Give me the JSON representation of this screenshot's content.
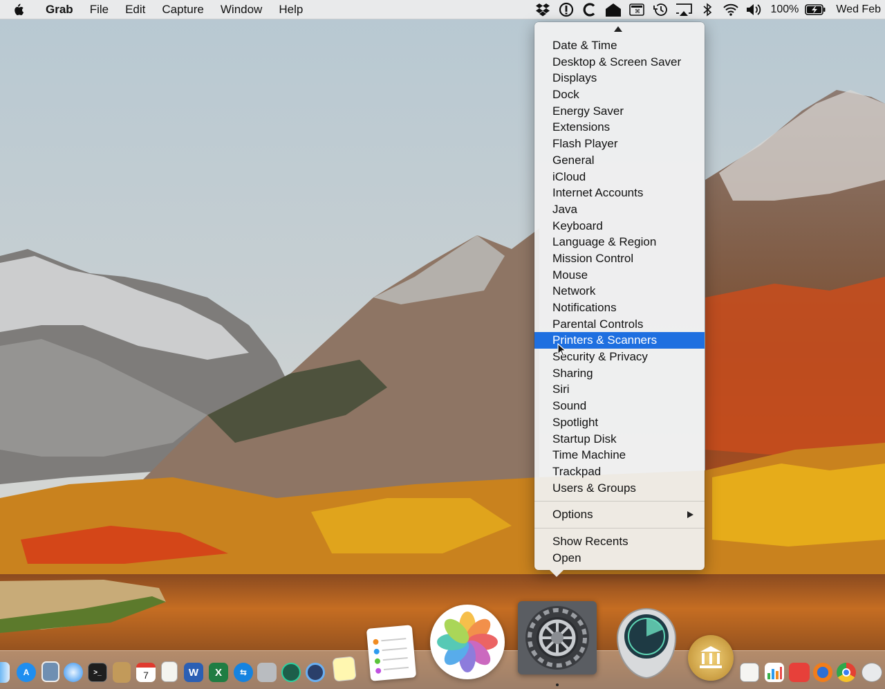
{
  "menubar": {
    "apple_icon": "apple-logo-icon",
    "app_name": "Grab",
    "menus": [
      "File",
      "Edit",
      "Capture",
      "Window",
      "Help"
    ],
    "status_icons": [
      "dropbox-icon",
      "info-circle-icon",
      "c-app-icon",
      "house-icon",
      "keyboard-viewer-icon",
      "time-machine-icon",
      "airplay-icon",
      "bluetooth-icon",
      "wifi-icon",
      "volume-icon"
    ],
    "battery_percent": "100%",
    "battery_icon": "battery-charging-icon",
    "clock": "Wed Feb"
  },
  "context_menu": {
    "scroll_up_icon": "scroll-up-arrow-icon",
    "items": [
      "Date & Time",
      "Desktop & Screen Saver",
      "Displays",
      "Dock",
      "Energy Saver",
      "Extensions",
      "Flash Player",
      "General",
      "iCloud",
      "Internet Accounts",
      "Java",
      "Keyboard",
      "Language & Region",
      "Mission Control",
      "Mouse",
      "Network",
      "Notifications",
      "Parental Controls",
      "Printers & Scanners",
      "Security & Privacy",
      "Sharing",
      "Siri",
      "Sound",
      "Spotlight",
      "Startup Disk",
      "Time Machine",
      "Trackpad",
      "Users & Groups"
    ],
    "selected_item": "Printers & Scanners",
    "options_label": "Options",
    "show_recents_label": "Show Recents",
    "open_label": "Open",
    "highlight_color": "#1e6fe0"
  },
  "dock": {
    "apps": [
      "finder-icon",
      "app-store-icon",
      "preview-icon",
      "safari-icon",
      "terminal-icon",
      "archive-icon",
      "calendar-icon",
      "textedit-icon",
      "word-icon",
      "excel-icon",
      "teamviewer-icon",
      "grab-icon",
      "time-machine-icon",
      "quicktime-icon",
      "notes-icon",
      "reminders-icon",
      "photos-icon",
      "system-preferences-icon",
      "disk-diag-icon",
      "library-icon",
      "textedit-doc-icon",
      "numbers-icon",
      "camera-icon",
      "firefox-icon",
      "chrome-icon",
      "unknown-icon"
    ],
    "calendar_day": "7",
    "word_letter": "W",
    "excel_letter": "X"
  }
}
